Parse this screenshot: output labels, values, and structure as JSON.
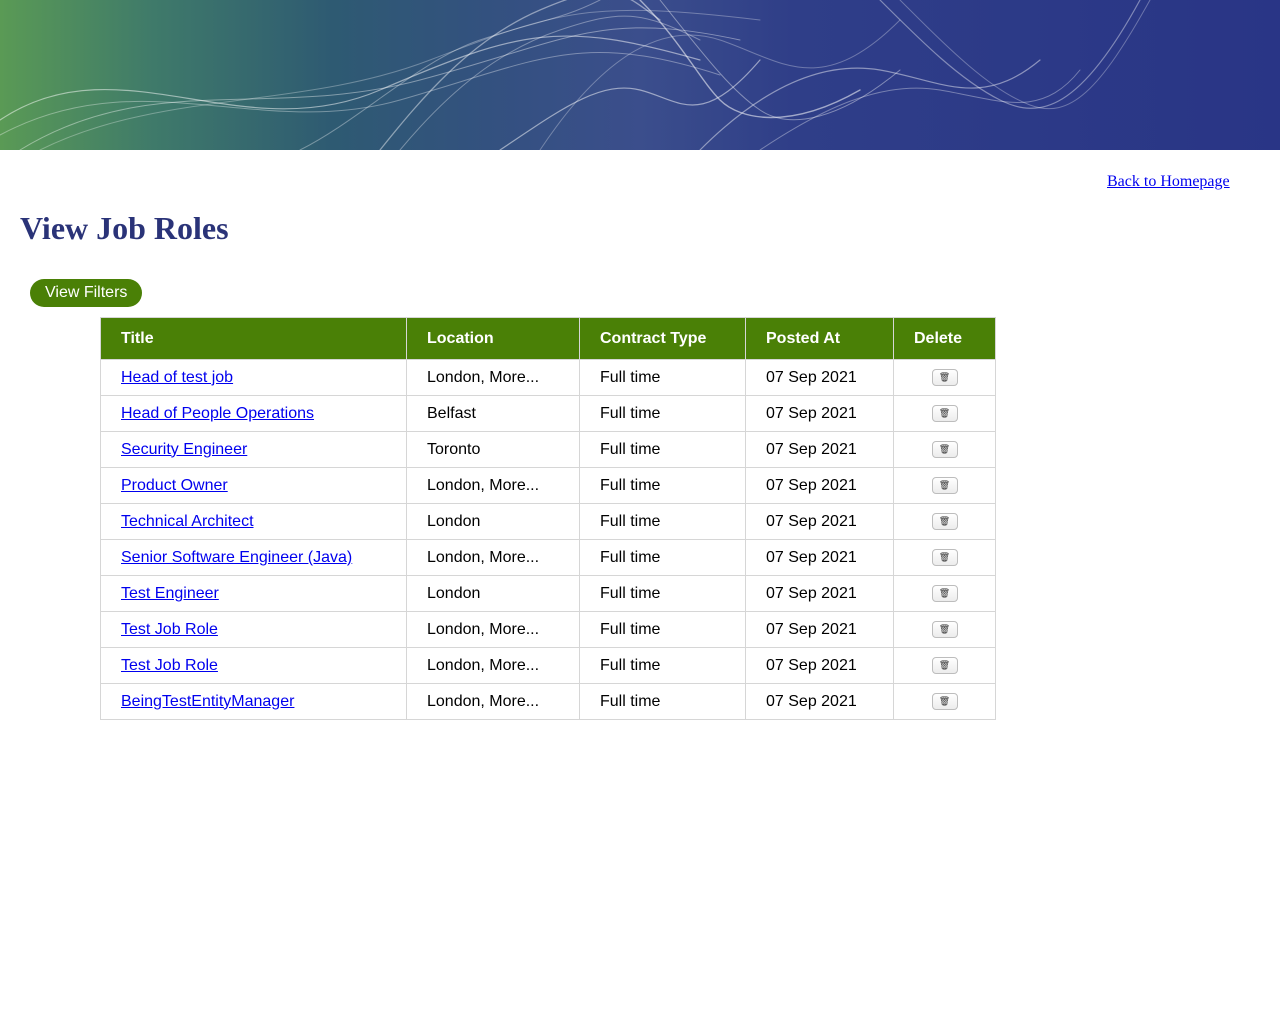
{
  "nav": {
    "back_label": "Back to Homepage"
  },
  "page": {
    "title": "View Job Roles",
    "filters_label": "View Filters"
  },
  "table": {
    "headers": {
      "title": "Title",
      "location": "Location",
      "contract": "Contract Type",
      "posted": "Posted At",
      "delete": "Delete"
    },
    "rows": [
      {
        "title": "Head of test job",
        "location": "London, More...",
        "contract": "Full time",
        "posted": "07 Sep 2021"
      },
      {
        "title": "Head of People Operations",
        "location": "Belfast",
        "contract": "Full time",
        "posted": "07 Sep 2021"
      },
      {
        "title": "Security Engineer",
        "location": "Toronto",
        "contract": "Full time",
        "posted": "07 Sep 2021"
      },
      {
        "title": "Product Owner",
        "location": "London, More...",
        "contract": "Full time",
        "posted": "07 Sep 2021"
      },
      {
        "title": "Technical Architect",
        "location": "London",
        "contract": "Full time",
        "posted": "07 Sep 2021"
      },
      {
        "title": "Senior Software Engineer (Java)",
        "location": "London, More...",
        "contract": "Full time",
        "posted": "07 Sep 2021"
      },
      {
        "title": "Test Engineer",
        "location": "London",
        "contract": "Full time",
        "posted": "07 Sep 2021"
      },
      {
        "title": "Test Job Role",
        "location": "London, More...",
        "contract": "Full time",
        "posted": "07 Sep 2021"
      },
      {
        "title": "Test Job Role",
        "location": "London, More...",
        "contract": "Full time",
        "posted": "07 Sep 2021"
      },
      {
        "title": "BeingTestEntityManager",
        "location": "London, More...",
        "contract": "Full time",
        "posted": "07 Sep 2021"
      }
    ],
    "delete_icon": "trash-icon"
  },
  "colors": {
    "accent_green": "#4a8006",
    "title_navy": "#2a3378",
    "link_blue": "#0000ee",
    "banner_blue": "#293586",
    "banner_green": "#5a9a55"
  }
}
